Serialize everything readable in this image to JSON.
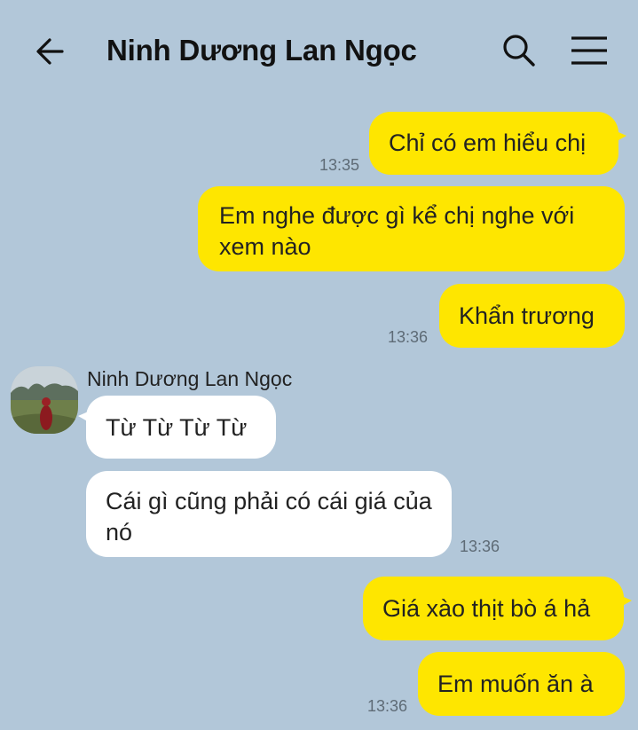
{
  "header": {
    "title": "Ninh Dương Lan Ngọc",
    "icons": {
      "back": "back-arrow-icon",
      "search": "search-icon",
      "menu": "menu-icon"
    }
  },
  "colors": {
    "background": "#b2c7d9",
    "my_bubble": "#fee600",
    "their_bubble": "#ffffff"
  },
  "contact": {
    "name": "Ninh Dương Lan Ngọc"
  },
  "messages": [
    {
      "from": "me",
      "text": "Chỉ có em hiểu chị"
    },
    {
      "from": "me",
      "text": "Em nghe được gì kể chị nghe với xem nào"
    },
    {
      "from": "me",
      "text": "Khẩn trương"
    },
    {
      "from": "them",
      "text": "Từ Từ Từ Từ"
    },
    {
      "from": "them",
      "text": "Cái gì cũng phải có cái giá của nó"
    },
    {
      "from": "me",
      "text": "Giá xào thịt bò á hả"
    },
    {
      "from": "me",
      "text": "Em muốn ăn à"
    }
  ],
  "timestamps": [
    "13:35",
    "13:36",
    "13:36",
    "13:36"
  ]
}
